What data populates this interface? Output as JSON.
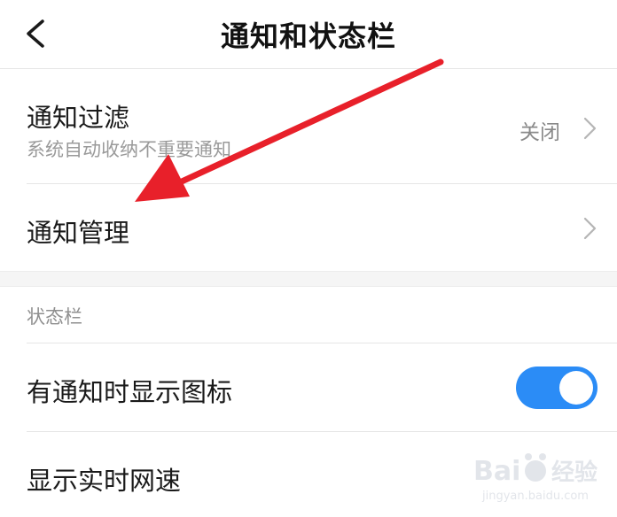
{
  "header": {
    "title": "通知和状态栏",
    "back_icon": "chevron-left-icon"
  },
  "notification_filter": {
    "title": "通知过滤",
    "subtitle": "系统自动收纳不重要通知",
    "value": "关闭"
  },
  "notification_management": {
    "title": "通知管理"
  },
  "status_bar_section": {
    "label": "状态栏",
    "items": [
      {
        "title": "有通知时显示图标",
        "toggle_on": true
      },
      {
        "title": "显示实时网速"
      }
    ]
  },
  "annotation": {
    "arrow_color": "#e8202a"
  },
  "watermark": {
    "brand": "Bai",
    "suffix": "经验",
    "sub": "jingyan.baidu.com"
  },
  "colors": {
    "accent": "#2b8cf6",
    "divider": "#e6e6e6",
    "secondary_text": "#9a9a9a"
  }
}
